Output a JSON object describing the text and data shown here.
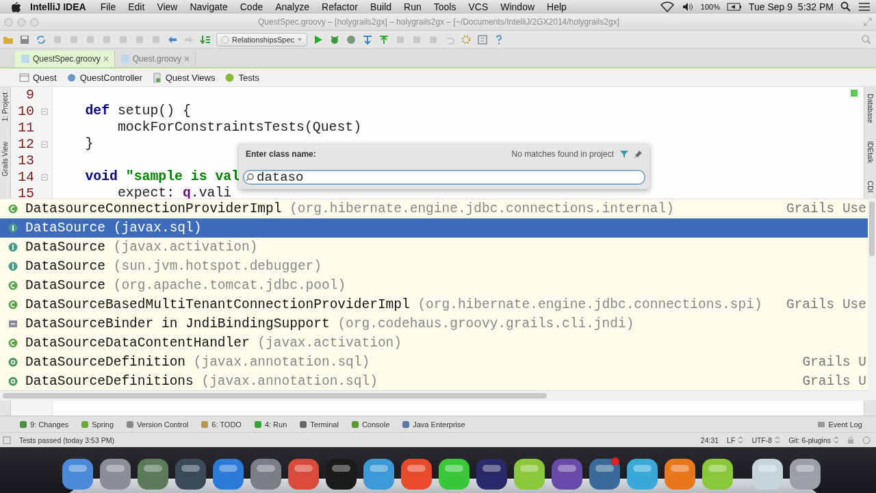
{
  "menu_bar": {
    "app": "IntelliJ IDEA",
    "items": [
      "File",
      "Edit",
      "View",
      "Navigate",
      "Code",
      "Analyze",
      "Refactor",
      "Build",
      "Run",
      "Tools",
      "VCS",
      "Window",
      "Help"
    ],
    "battery": "100%",
    "clock": "Tue Sep 9  5:32 PM"
  },
  "window": {
    "title": "QuestSpec.groovy – [holygrails2gx] – holygrails2gx – [~/Documents/IntelliJ/2GX2014/holygrails2gx]"
  },
  "toolbar": {
    "run_config": "RelationshipsSpec"
  },
  "tabs": [
    {
      "label": "QuestSpec.groovy",
      "selected": true
    },
    {
      "label": "Quest.groovy",
      "selected": false
    }
  ],
  "breadcrumbs": [
    "Quest",
    "QuestController",
    "Quest Views",
    "Tests"
  ],
  "left_strip": [
    "1: Project",
    "Grails View"
  ],
  "right_strip": [
    "Database",
    "IDEtalk",
    "CDI"
  ],
  "editor": {
    "lines": [
      {
        "number": "9",
        "fold": false
      },
      {
        "number": "10",
        "fold": true,
        "tokens": [
          {
            "kind": "keyword",
            "text": "    def"
          },
          {
            "kind": "plain",
            "text": " setup() {"
          }
        ]
      },
      {
        "number": "11",
        "fold": false,
        "tokens": [
          {
            "kind": "plain",
            "text": "        mockForConstraintsTests(Quest)"
          }
        ]
      },
      {
        "number": "12",
        "fold": true,
        "tokens": [
          {
            "kind": "plain",
            "text": "    }"
          }
        ]
      },
      {
        "number": "13",
        "fold": false
      },
      {
        "number": "14",
        "fold": true,
        "tokens": [
          {
            "kind": "keyword",
            "text": "    void"
          },
          {
            "kind": "string",
            "text": " \"sample is val"
          }
        ]
      },
      {
        "number": "15",
        "fold": false,
        "tokens": [
          {
            "kind": "plain",
            "text": "        expect: "
          },
          {
            "kind": "field",
            "text": "q"
          },
          {
            "kind": "plain",
            "text": ".vali"
          }
        ]
      }
    ]
  },
  "class_popup": {
    "label": "Enter class name:",
    "status": "No matches found in project",
    "value": "dataso"
  },
  "completions": [
    {
      "name": "DatasourceConnectionProviderImpl",
      "package": "(org.hibernate.engine.jdbc.connections.internal)",
      "scope": "Grails Use",
      "kind": "class",
      "selected": false
    },
    {
      "name": "DataSource",
      "package": "(javax.sql)",
      "kind": "interface",
      "selected": true
    },
    {
      "name": "DataSource",
      "package": "(javax.activation)",
      "kind": "interface",
      "selected": false
    },
    {
      "name": "DataSource",
      "package": "(sun.jvm.hotspot.debugger)",
      "kind": "interface",
      "selected": false
    },
    {
      "name": "DataSource",
      "package": "(org.apache.tomcat.jdbc.pool)",
      "kind": "class",
      "selected": false
    },
    {
      "name": "DataSourceBasedMultiTenantConnectionProviderImpl",
      "package": "(org.hibernate.engine.jdbc.connections.spi)",
      "scope": "Grails Use",
      "kind": "class",
      "selected": false
    },
    {
      "name": "DataSourceBinder in JndiBindingSupport",
      "package": "(org.codehaus.groovy.grails.cli.jndi)",
      "kind": "inner",
      "selected": false
    },
    {
      "name": "DataSourceDataContentHandler",
      "package": "(javax.activation)",
      "kind": "class",
      "selected": false
    },
    {
      "name": "DataSourceDefinition",
      "package": "(javax.annotation.sql)",
      "scope": "Grails U",
      "kind": "annotation",
      "selected": false
    },
    {
      "name": "DataSourceDefinitions",
      "package": "(javax.annotation.sql)",
      "scope": "Grails U",
      "kind": "annotation",
      "selected": false
    }
  ],
  "tool_windows": [
    {
      "label": "9: Changes",
      "color": "#4a8f3c"
    },
    {
      "label": "Spring",
      "color": "#6aaa3a"
    },
    {
      "label": "Version Control",
      "color": "#8a8a8a"
    },
    {
      "label": "6: TODO",
      "color": "#b89a4a"
    },
    {
      "label": "4: Run",
      "color": "#3aa03a"
    },
    {
      "label": "Terminal",
      "color": "#666666"
    },
    {
      "label": "Console",
      "color": "#5a9a2a"
    },
    {
      "label": "Java Enterprise",
      "color": "#5a7aa0"
    }
  ],
  "event_log": "Event Log",
  "status_bar": {
    "message": "Tests passed (today 3:53 PM)",
    "position": "24:31",
    "line_ending": "LF",
    "encoding": "UTF-8",
    "vcs": "Git: 6-plugins"
  },
  "dock": [
    {
      "color": "#4a8ad8"
    },
    {
      "color": "#8a8e96"
    },
    {
      "color": "#5a7a5a"
    },
    {
      "color": "#3a4a5a"
    },
    {
      "color": "#2a7ad8"
    },
    {
      "color": "#7a7e86"
    },
    {
      "color": "#d84a3a"
    },
    {
      "color": "#1a1a1a"
    },
    {
      "color": "#3a9ad8"
    },
    {
      "color": "#e84a2a"
    },
    {
      "color": "#3ac83a"
    },
    {
      "color": "#2a2a6a"
    },
    {
      "color": "#8ac83a"
    },
    {
      "color": "#6a4aa8"
    },
    {
      "color": "#3a6a9a",
      "badge": true
    },
    {
      "color": "#3aa8d8"
    },
    {
      "color": "#e8781a"
    },
    {
      "color": "#8ac83a"
    },
    {
      "color": "#c8d4dc"
    },
    {
      "color": "#9aa0a6"
    }
  ]
}
